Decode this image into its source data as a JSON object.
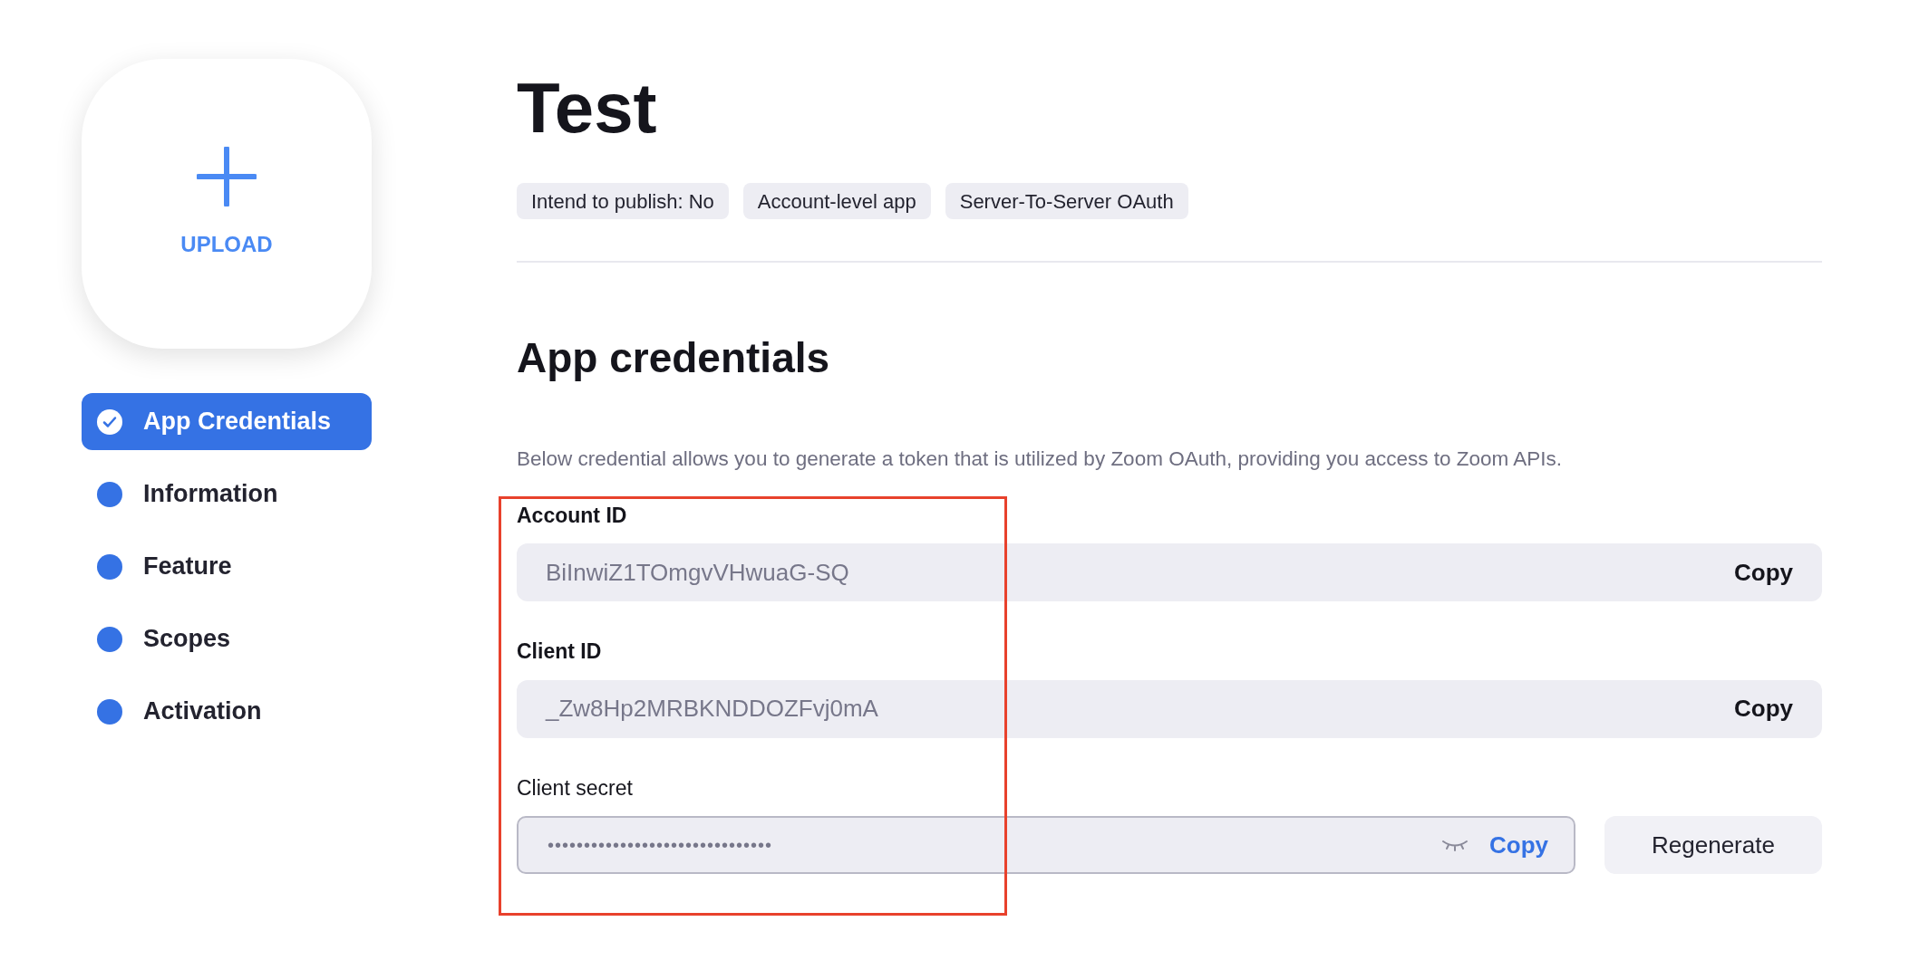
{
  "upload": {
    "label": "UPLOAD"
  },
  "nav": [
    {
      "label": "App Credentials",
      "selected": true,
      "done": true
    },
    {
      "label": "Information",
      "selected": false,
      "done": false
    },
    {
      "label": "Feature",
      "selected": false,
      "done": false
    },
    {
      "label": "Scopes",
      "selected": false,
      "done": false
    },
    {
      "label": "Activation",
      "selected": false,
      "done": false
    }
  ],
  "title": "Test",
  "tags": [
    "Intend to publish: No",
    "Account-level app",
    "Server-To-Server OAuth"
  ],
  "section_title": "App credentials",
  "description": "Below credential allows you to generate a token that is utilized by Zoom OAuth, providing you access to Zoom APIs.",
  "fields": [
    {
      "label": "Account ID",
      "value": "BiInwiZ1TOmgvVHwuaG-SQ",
      "copy": "Copy",
      "kind": "plain"
    },
    {
      "label": "Client ID",
      "value": "_Zw8Hp2MRBKNDDOZFvj0mA",
      "copy": "Copy",
      "kind": "plain"
    },
    {
      "label": "Client secret",
      "value": "•••••••••••••••••••••••••••••••",
      "copy": "Copy",
      "kind": "secret",
      "action": "Regenerate"
    }
  ]
}
